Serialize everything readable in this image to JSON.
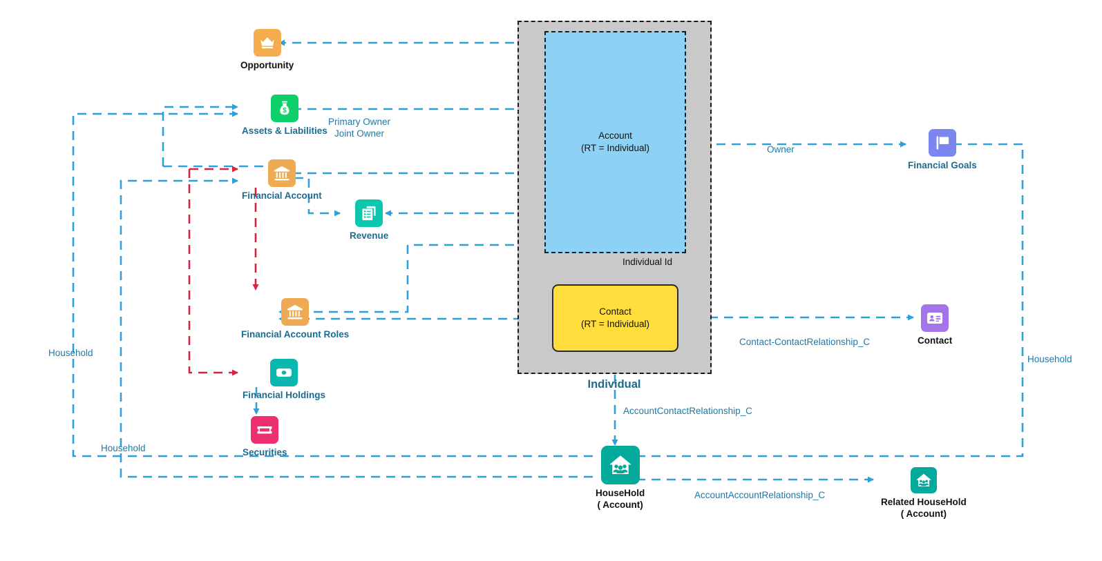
{
  "diagram": {
    "title": "Individual",
    "colors": {
      "blue_link": "#2d9fdb",
      "red_link": "#d8213c",
      "label_blue": "#1b7aa8",
      "group_fill": "#c9c9c9",
      "account_fill": "#8dd2f5",
      "contact_fill": "#ffdd3c"
    }
  },
  "group": {
    "title": "Individual",
    "account": {
      "line1": "Account",
      "line2": "(RT = Individual)"
    },
    "contact": {
      "line1": "Contact",
      "line2": "(RT = Individual)"
    },
    "internal_edge_label": "Individual Id"
  },
  "nodes": [
    {
      "id": "opportunity",
      "label": "Opportunity",
      "icon": "crown-icon",
      "color": "#f5ac4e"
    },
    {
      "id": "assets",
      "label": "Assets & Liabilities",
      "icon": "money-bag-icon",
      "color": "#0ed06a"
    },
    {
      "id": "financial-account",
      "label": "Financial Account",
      "icon": "bank-icon",
      "color": "#eda košice"
    },
    {
      "id": "revenue",
      "label": "Revenue",
      "icon": "documents-icon",
      "color": "#0cc7ad"
    },
    {
      "id": "far",
      "label": "Financial Account Roles",
      "icon": "bank-icon",
      "color": "#eeaa55"
    },
    {
      "id": "holdings",
      "label": "Financial Holdings",
      "icon": "banknote-icon",
      "color": "#0bb7ae"
    },
    {
      "id": "securities",
      "label": "Securities",
      "icon": "ticket-icon",
      "color": "#ec2f70"
    },
    {
      "id": "goals",
      "label": "Financial Goals",
      "icon": "flag-icon",
      "color": "#7b86ef"
    },
    {
      "id": "contact",
      "label": "Contact",
      "icon": "contact-card-icon",
      "color": "#a474e8"
    },
    {
      "id": "household",
      "label_line1": "HouseHold",
      "label_line2": "( Account)",
      "icon": "household-icon",
      "color": "#03a99a"
    },
    {
      "id": "related-household",
      "label_line1": "Related HouseHold",
      "label_line2": "( Account)",
      "icon": "household-icon",
      "color": "#03a99a"
    }
  ],
  "edge_labels": {
    "primary_owner": "Primary Owner",
    "joint_owner": "Joint Owner",
    "owner": "Owner",
    "contact_contact_rel": "Contact-ContactRelationship_C",
    "account_contact_rel": "AccountContactRelationship_C",
    "account_account_rel": "AccountAccountRelationship_C",
    "household_left_upper": "Household",
    "household_left_lower": "Household",
    "household_right": "Household"
  },
  "node_labels": {
    "opportunity": "Opportunity",
    "assets": "Assets & Liabilities",
    "financial_account": "Financial Account",
    "revenue": "Revenue",
    "financial_account_roles": "Financial Account Roles",
    "financial_holdings": "Financial Holdings",
    "securities": "Securities",
    "financial_goals": "Financial Goals",
    "contact": "Contact",
    "household_l1": "HouseHold",
    "household_l2": "( Account)",
    "related_household_l1": "Related HouseHold",
    "related_household_l2": "( Account)"
  }
}
